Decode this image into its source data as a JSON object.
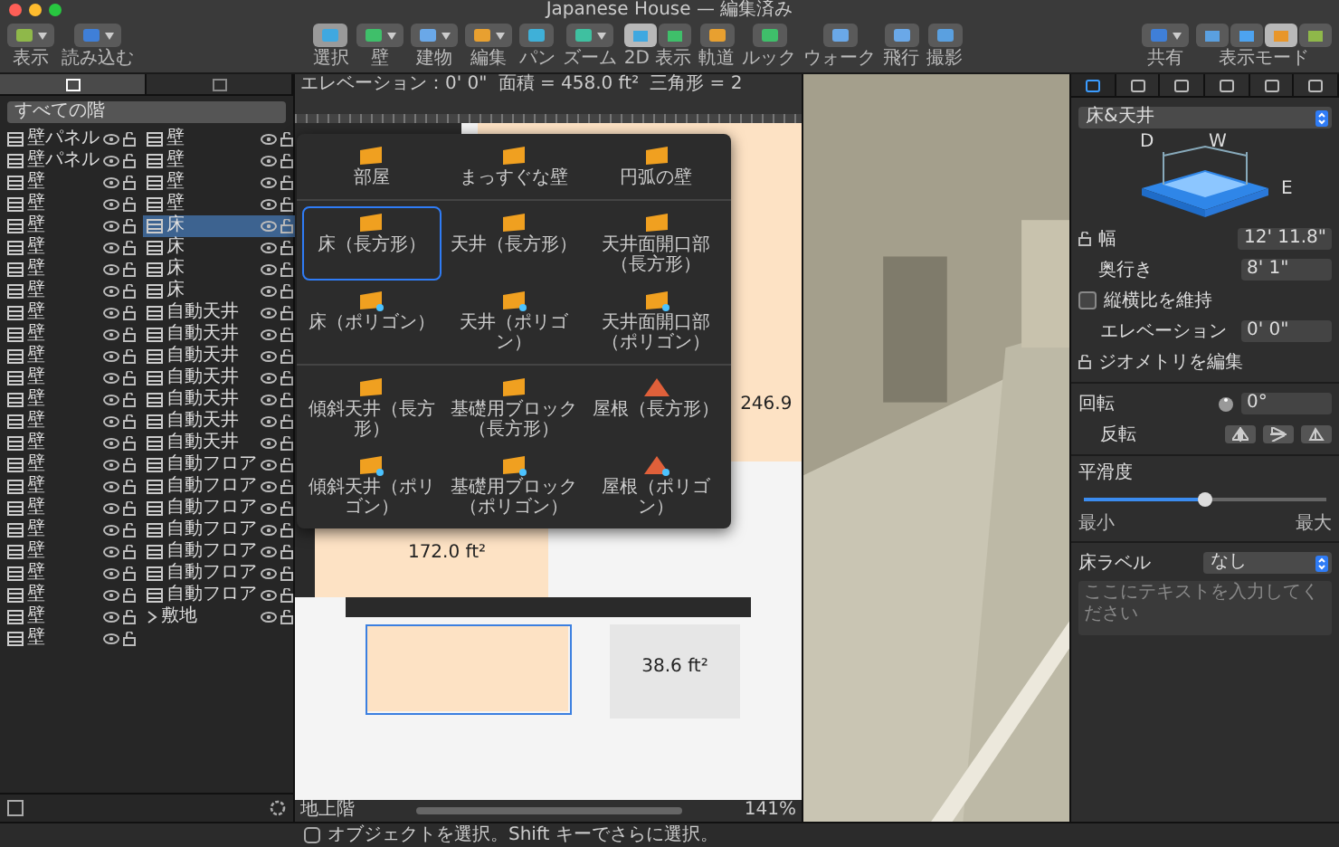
{
  "window": {
    "title": "Japanese House — 編集済み"
  },
  "toolbar": {
    "left": [
      {
        "label": "表示",
        "kind": "button",
        "menu": true,
        "selected": false
      },
      {
        "label": "読み込む",
        "kind": "button",
        "menu": true,
        "selected": false
      }
    ],
    "center": [
      {
        "label": "選択",
        "kind": "button",
        "menu": false,
        "selected": true
      },
      {
        "label": "壁",
        "kind": "button",
        "menu": true,
        "selected": false
      },
      {
        "label": "建物",
        "kind": "button",
        "menu": true,
        "selected": false
      },
      {
        "label": "編集",
        "kind": "button",
        "menu": true,
        "selected": false
      },
      {
        "label": "パン",
        "kind": "button",
        "menu": false,
        "selected": false
      },
      {
        "label": "ズーム",
        "kind": "button",
        "menu": true,
        "selected": false
      },
      {
        "label": "2D 表示",
        "kind": "segmented",
        "segments": [
          {
            "selected": true
          },
          {
            "selected": false
          }
        ]
      },
      {
        "label": "軌道",
        "kind": "button",
        "menu": false,
        "selected": false
      },
      {
        "label": "ルック",
        "kind": "button",
        "menu": false,
        "selected": false
      },
      {
        "label": "ウォーク",
        "kind": "button",
        "menu": false,
        "selected": false
      },
      {
        "label": "飛行",
        "kind": "button",
        "menu": false,
        "selected": false
      },
      {
        "label": "撮影",
        "kind": "button",
        "menu": false,
        "selected": false
      }
    ],
    "right": [
      {
        "label": "共有",
        "kind": "button",
        "menu": true,
        "selected": false
      },
      {
        "label": "表示モード",
        "kind": "segmented",
        "segments": [
          {
            "selected": false
          },
          {
            "selected": false
          },
          {
            "selected": true
          },
          {
            "selected": false
          }
        ]
      }
    ]
  },
  "sidebar": {
    "tabs": [
      {
        "selected": true
      },
      {
        "selected": false
      }
    ],
    "header": "すべての階",
    "items": [
      {
        "label": "壁パネル",
        "kind": "item",
        "selected": false
      },
      {
        "label": "壁パネル",
        "kind": "item",
        "selected": false
      },
      {
        "label": "壁",
        "kind": "item",
        "selected": false
      },
      {
        "label": "壁",
        "kind": "item",
        "selected": false
      },
      {
        "label": "壁",
        "kind": "item",
        "selected": false
      },
      {
        "label": "壁",
        "kind": "item",
        "selected": false
      },
      {
        "label": "壁",
        "kind": "item",
        "selected": false
      },
      {
        "label": "壁",
        "kind": "item",
        "selected": false
      },
      {
        "label": "壁",
        "kind": "item",
        "selected": false
      },
      {
        "label": "壁",
        "kind": "item",
        "selected": false
      },
      {
        "label": "壁",
        "kind": "item",
        "selected": false
      },
      {
        "label": "壁",
        "kind": "item",
        "selected": false
      },
      {
        "label": "壁",
        "kind": "item",
        "selected": false
      },
      {
        "label": "壁",
        "kind": "item",
        "selected": false
      },
      {
        "label": "壁",
        "kind": "item",
        "selected": false
      },
      {
        "label": "壁",
        "kind": "item",
        "selected": false
      },
      {
        "label": "壁",
        "kind": "item",
        "selected": false
      },
      {
        "label": "壁",
        "kind": "item",
        "selected": false
      },
      {
        "label": "壁",
        "kind": "item",
        "selected": false
      },
      {
        "label": "壁",
        "kind": "item",
        "selected": false
      },
      {
        "label": "壁",
        "kind": "item",
        "selected": false
      },
      {
        "label": "壁",
        "kind": "item",
        "selected": false
      },
      {
        "label": "壁",
        "kind": "item",
        "selected": false
      },
      {
        "label": "壁",
        "kind": "item",
        "selected": false
      },
      {
        "label": "壁",
        "kind": "item",
        "selected": false
      },
      {
        "label": "壁",
        "kind": "item",
        "selected": false
      },
      {
        "label": "壁",
        "kind": "item",
        "selected": false
      },
      {
        "label": "壁",
        "kind": "item",
        "selected": false
      },
      {
        "label": "床",
        "kind": "item",
        "selected": true
      },
      {
        "label": "床",
        "kind": "item",
        "selected": false
      },
      {
        "label": "床",
        "kind": "item",
        "selected": false
      },
      {
        "label": "床",
        "kind": "item",
        "selected": false
      },
      {
        "label": "自動天井",
        "kind": "item",
        "selected": false
      },
      {
        "label": "自動天井",
        "kind": "item",
        "selected": false
      },
      {
        "label": "自動天井",
        "kind": "item",
        "selected": false
      },
      {
        "label": "自動天井",
        "kind": "item",
        "selected": false
      },
      {
        "label": "自動天井",
        "kind": "item",
        "selected": false
      },
      {
        "label": "自動天井",
        "kind": "item",
        "selected": false
      },
      {
        "label": "自動天井",
        "kind": "item",
        "selected": false
      },
      {
        "label": "自動フロア",
        "kind": "item",
        "selected": false
      },
      {
        "label": "自動フロア",
        "kind": "item",
        "selected": false
      },
      {
        "label": "自動フロア",
        "kind": "item",
        "selected": false
      },
      {
        "label": "自動フロア",
        "kind": "item",
        "selected": false
      },
      {
        "label": "自動フロア",
        "kind": "item",
        "selected": false
      },
      {
        "label": "自動フロア",
        "kind": "item",
        "selected": false
      },
      {
        "label": "自動フロア",
        "kind": "item",
        "selected": false
      },
      {
        "label": "敷地",
        "kind": "group",
        "selected": false,
        "expanded": false
      }
    ]
  },
  "tool_menu": {
    "sections": [
      [
        {
          "label": "部屋",
          "selected": false
        },
        {
          "label": "まっすぐな壁",
          "selected": false
        },
        {
          "label": "円弧の壁",
          "selected": false
        }
      ],
      [
        {
          "label": "床（長方形）",
          "selected": true
        },
        {
          "label": "天井（長方形）",
          "selected": false
        },
        {
          "label": "天井面開口部（長方形）",
          "selected": false
        },
        {
          "label": "床（ポリゴン）",
          "selected": false
        },
        {
          "label": "天井（ポリゴン）",
          "selected": false
        },
        {
          "label": "天井面開口部（ポリゴン）",
          "selected": false
        }
      ],
      [
        {
          "label": "傾斜天井（長方形）",
          "selected": false
        },
        {
          "label": "基礎用ブロック（長方形）",
          "selected": false
        },
        {
          "label": "屋根（長方形）",
          "selected": false
        },
        {
          "label": "傾斜天井（ポリゴン）",
          "selected": false
        },
        {
          "label": "基礎用ブロック（ポリゴン）",
          "selected": false
        },
        {
          "label": "屋根（ポリゴン）",
          "selected": false
        }
      ]
    ]
  },
  "plan": {
    "info": [
      "エレベーション：0' 0\"",
      "面積 = 458.0 ft²",
      "三角形 = 2"
    ],
    "area_labels": [
      "246.9",
      "38.6 ft²",
      "172.0 ft²"
    ],
    "floor": "地上階",
    "zoom": "141%"
  },
  "inspector": {
    "tabs": [
      {
        "selected": true
      },
      {
        "selected": false
      },
      {
        "selected": false
      },
      {
        "selected": false
      },
      {
        "selected": false
      },
      {
        "selected": false
      }
    ],
    "object_type": "床&天井",
    "dimension_letters": [
      "D",
      "W",
      "E"
    ],
    "width_label": "幅",
    "width": "12' 11.8\"",
    "depth_label": "奥行き",
    "depth": "8' 1\"",
    "keep_ratio": {
      "label": "縦横比を維持",
      "checked": false
    },
    "elevation_label": "エレベーション",
    "elevation": "0' 0\"",
    "edit_geometry": "ジオメトリを編集",
    "rotation_label": "回転",
    "rotation": "0°",
    "flip_label": "反転",
    "smoothness": {
      "label": "平滑度",
      "level": 0.5,
      "min": "最小",
      "max": "最大"
    },
    "floor_label": {
      "label": "床ラベル",
      "value": "なし",
      "placeholder": "ここにテキストを入力してください"
    }
  },
  "status_bar": {
    "message": "オブジェクトを選択。Shift キーでさらに選択。"
  }
}
